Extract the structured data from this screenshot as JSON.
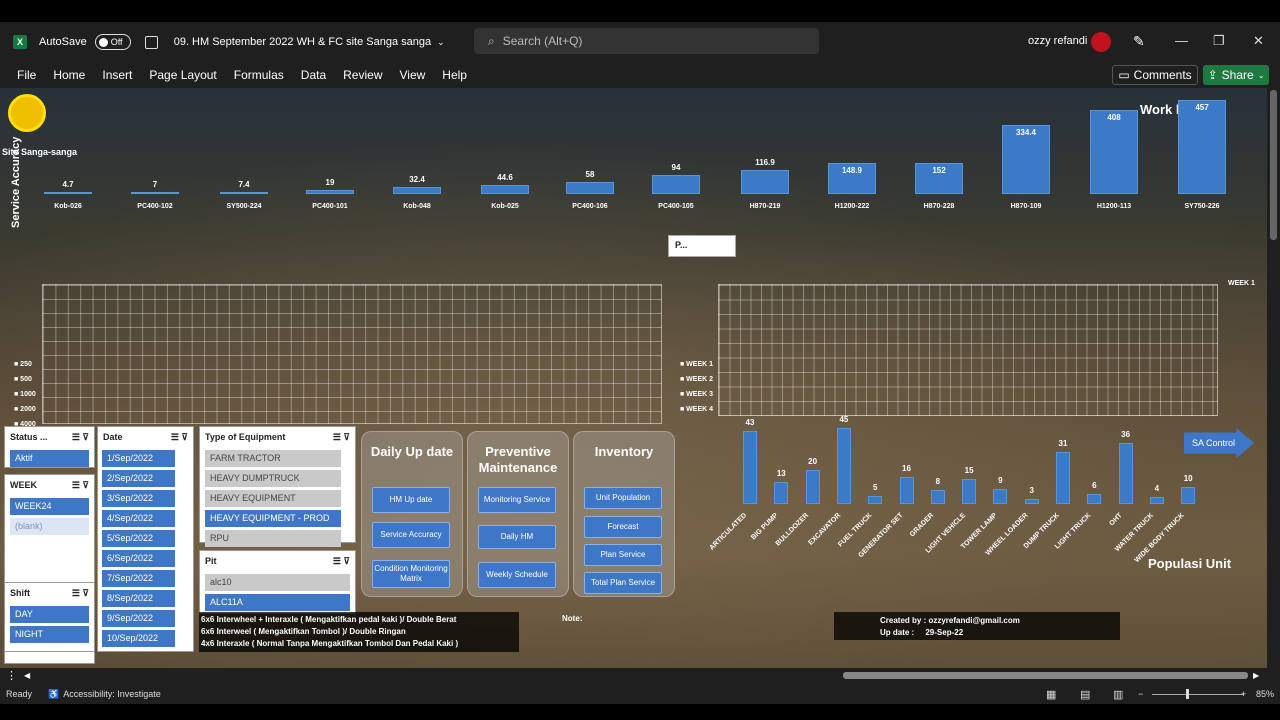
{
  "titlebar": {
    "autosave_label": "AutoSave",
    "autosave_state": "Off",
    "filename": "09. HM September 2022 WH & FC site Sanga sanga",
    "search_placeholder": "Search (Alt+Q)",
    "user_name": "ozzy refandi"
  },
  "menu": [
    "File",
    "Home",
    "Insert",
    "Page Layout",
    "Formulas",
    "Data",
    "Review",
    "View",
    "Help"
  ],
  "buttons": {
    "comments": "Comments",
    "share": "Share"
  },
  "status": {
    "ready": "Ready",
    "accessibility": "Accessibility: Investigate",
    "zoom": "85%"
  },
  "dashboard": {
    "site_label": "Site Sanga-sanga",
    "work_hours_title": "Work hours",
    "service_accuracy_axis": "Service Accuracy",
    "populasi_title": "Populasi Unit",
    "sa_control": "SA Control",
    "pivot_button": "P...",
    "week_legend": "WEEK 1"
  },
  "work_hours": {
    "categories": [
      "Kob-026",
      "PC400-102",
      "SY500-224",
      "PC400-101",
      "Kob-048",
      "Kob-025",
      "PC400-106",
      "PC400-105",
      "H870-219",
      "H1200-222",
      "H870-228",
      "H870-109",
      "H1200-113",
      "SY750-226"
    ],
    "values": [
      4.7,
      7,
      7.4,
      19,
      32.4,
      44.6,
      58,
      94,
      116.9,
      148.9,
      152,
      334.4,
      408,
      457
    ]
  },
  "sa_grid": {
    "row_labels": [
      "250",
      "500",
      "1000",
      "2000",
      "4000"
    ],
    "right_row_labels": [
      "WEEK 1",
      "WEEK 2",
      "WEEK 3",
      "WEEK 4"
    ]
  },
  "slicers": {
    "status": {
      "title": "Status ...",
      "items": [
        "Aktif"
      ]
    },
    "week": {
      "title": "WEEK",
      "items": [
        "WEEK24",
        "(blank)"
      ]
    },
    "shift": {
      "title": "Shift",
      "items": [
        "DAY",
        "NIGHT"
      ]
    },
    "date": {
      "title": "Date",
      "items": [
        "1/Sep/2022",
        "2/Sep/2022",
        "3/Sep/2022",
        "4/Sep/2022",
        "5/Sep/2022",
        "6/Sep/2022",
        "7/Sep/2022",
        "8/Sep/2022",
        "9/Sep/2022",
        "10/Sep/2022"
      ]
    },
    "type": {
      "title": "Type of Equipment",
      "items": [
        "FARM TRACTOR",
        "HEAVY DUMPTRUCK",
        "HEAVY EQUIPMENT",
        "HEAVY EQUIPMENT - PROD",
        "RPU"
      ]
    },
    "pit": {
      "title": "Pit",
      "items": [
        "alc10",
        "ALC11A"
      ]
    }
  },
  "categories": {
    "daily": {
      "title": "Daily Up date",
      "buttons": [
        "HM Up date",
        "Service Accuracy",
        "Condition Monitoring Matrix"
      ]
    },
    "pm": {
      "title": "Preventive Maintenance",
      "buttons": [
        "Monitoring Service",
        "Daily HM",
        "Weekly Schedule"
      ]
    },
    "inventory": {
      "title": "Inventory",
      "buttons": [
        "Unit Population",
        "Forecast",
        "Plan Service",
        "Total Plan Service"
      ]
    }
  },
  "populasi": {
    "categories": [
      "ARTICULATED",
      "BIG PUMP",
      "BULLDOZER",
      "EXCAVATOR",
      "FUEL TRUCK",
      "GENERATOR SET",
      "GRADER",
      "LIGHT VEHICLE",
      "TOWER LAMP",
      "WHEEL LOADER",
      "DUMP TRUCK",
      "LIGHT TRUCK",
      "OHT",
      "WATER TRUCK",
      "WIDE BODY TRUCK"
    ],
    "values": [
      43,
      13,
      20,
      45,
      5,
      16,
      8,
      15,
      9,
      3,
      31,
      6,
      36,
      4,
      10
    ]
  },
  "notes": {
    "lines": [
      "6x6 Interwheel + Interaxle ( Mengaktifkan pedal kaki )/ Double Berat",
      "6x6 Interweel ( Mengaktifkan Tombol )/ Double Ringan",
      "4x6 Interaxle ( Normal Tanpa Mengaktifkan Tombol Dan Pedal Kaki )"
    ],
    "note_label": "Note:",
    "created_by": "Created by : ozzyrefandi@gmail.com",
    "up_date_label": "Up date :",
    "up_date_value": "29-Sep-22"
  }
}
